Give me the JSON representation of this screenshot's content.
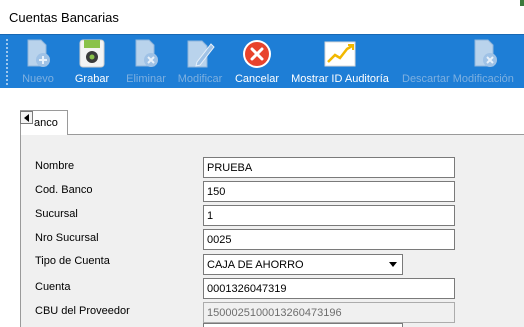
{
  "window": {
    "title": "Cuentas Bancarias"
  },
  "toolbar": {
    "buttons": [
      {
        "label": "Nuevo",
        "icon": "new-document-icon",
        "enabled": false
      },
      {
        "label": "Grabar",
        "icon": "save-disk-icon",
        "enabled": true
      },
      {
        "label": "Eliminar",
        "icon": "delete-document-icon",
        "enabled": false
      },
      {
        "label": "Modificar",
        "icon": "edit-pencil-icon",
        "enabled": false
      },
      {
        "label": "Cancelar",
        "icon": "cancel-icon",
        "enabled": true
      },
      {
        "label": "Mostrar ID Auditoría",
        "icon": "audit-chart-icon",
        "enabled": true
      },
      {
        "label": "Descartar Modificación",
        "icon": "discard-document-icon",
        "enabled": false
      }
    ],
    "colors": {
      "background": "#1e7ed6",
      "enabled_text": "#ffffff",
      "disabled_text": "#7eb0e0"
    }
  },
  "tabs": {
    "active_label": "anco"
  },
  "form": {
    "nombre": {
      "label": "Nombre",
      "value": "PRUEBA"
    },
    "cod_banco": {
      "label": "Cod. Banco",
      "value": "150"
    },
    "sucursal": {
      "label": "Sucursal",
      "value": "1"
    },
    "nro_sucursal": {
      "label": "Nro Sucursal",
      "value": "0025"
    },
    "tipo_cuenta": {
      "label": "Tipo de Cuenta",
      "value": "CAJA DE AHORRO"
    },
    "cuenta": {
      "label": "Cuenta",
      "value": "0001326047319"
    },
    "cbu": {
      "label": "CBU del Proveedor",
      "value": "1500025100013260473196"
    }
  }
}
